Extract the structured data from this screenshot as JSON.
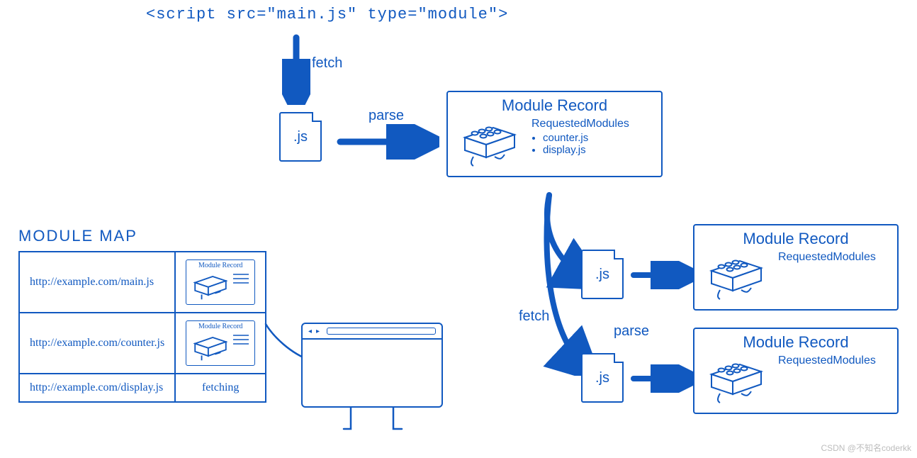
{
  "script_tag_text": "<script  src=\"main.js\"  type=\"module\">",
  "labels": {
    "fetch_top": "fetch",
    "parse_top": "parse",
    "fetch_mid": "fetch",
    "parse_mid": "parse",
    "map_title": "MODULE  MAP"
  },
  "file_labels": {
    "main": ".js",
    "child1": ".js",
    "child2": ".js"
  },
  "record_main": {
    "title": "Module Record",
    "sub": "RequestedModules",
    "items": [
      "counter.js",
      "display.js"
    ]
  },
  "record_child": {
    "title": "Module Record",
    "sub": "RequestedModules"
  },
  "mini_record_title": "Module Record",
  "module_map": [
    {
      "url": "http://example.com/main.js",
      "status": "record"
    },
    {
      "url": "http://example.com/counter.js",
      "status": "record"
    },
    {
      "url": "http://example.com/display.js",
      "status": "fetching"
    }
  ],
  "fetching_label": "fetching",
  "watermark": "CSDN @不知名coderkk"
}
